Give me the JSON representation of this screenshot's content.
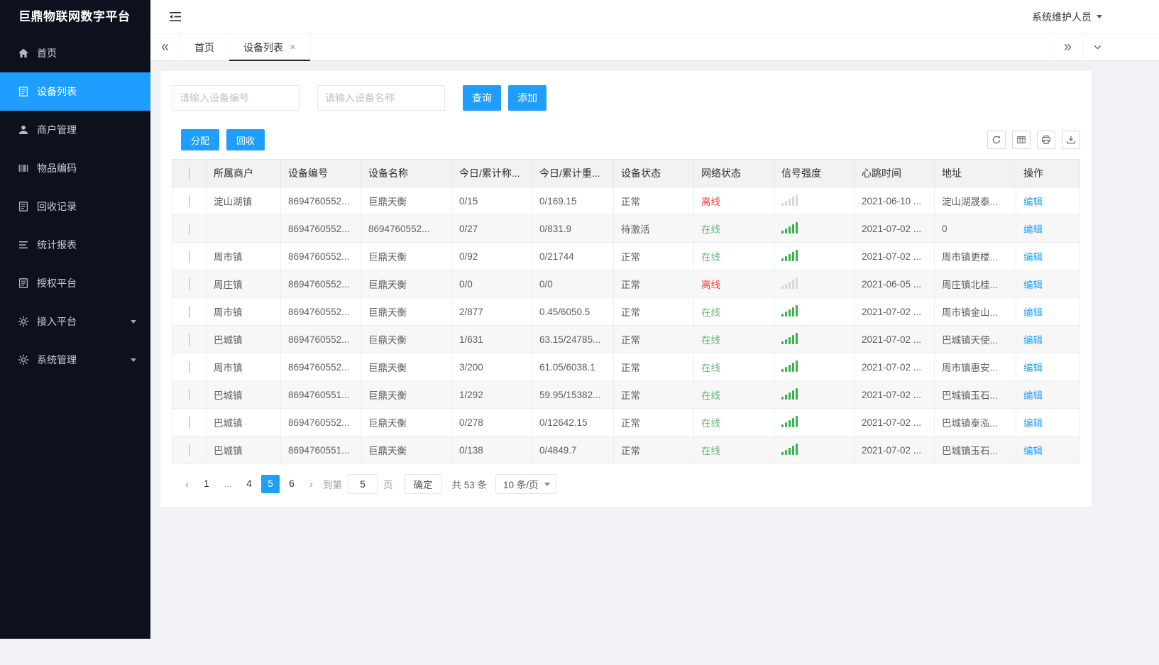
{
  "app": {
    "title": "巨鼎物联网数字平台",
    "user_name": "系统维护人员"
  },
  "colors": {
    "accent": "#1e9fff",
    "sidebar_bg": "#0c111d",
    "page_bg": "#f0f2f5",
    "online_green": "#5fb878",
    "offline_red": "#ff3b3b",
    "signal_strong": "#36b34a",
    "signal_weak": "#d8d8d8",
    "link_blue": "#1e9fff"
  },
  "sidebar": {
    "items": [
      {
        "label": "首页",
        "icon": "home-icon",
        "active": false,
        "expandable": false
      },
      {
        "label": "设备列表",
        "icon": "device-list-icon",
        "active": true,
        "expandable": false
      },
      {
        "label": "商户管理",
        "icon": "merchant-icon",
        "active": false,
        "expandable": false
      },
      {
        "label": "物品编码",
        "icon": "item-code-icon",
        "active": false,
        "expandable": false
      },
      {
        "label": "回收记录",
        "icon": "recycle-record-icon",
        "active": false,
        "expandable": false
      },
      {
        "label": "统计报表",
        "icon": "report-icon",
        "active": false,
        "expandable": false
      },
      {
        "label": "授权平台",
        "icon": "auth-platform-icon",
        "active": false,
        "expandable": false
      },
      {
        "label": "接入平台",
        "icon": "access-platform-icon",
        "active": false,
        "expandable": true
      },
      {
        "label": "系统管理",
        "icon": "system-manage-icon",
        "active": false,
        "expandable": true
      }
    ]
  },
  "tabs": {
    "items": [
      {
        "label": "首页",
        "active": false,
        "closable": false
      },
      {
        "label": "设备列表",
        "active": true,
        "closable": true
      }
    ]
  },
  "filters": {
    "device_no_placeholder": "请输入设备编号",
    "device_name_placeholder": "请输入设备名称",
    "search_label": "查询",
    "add_label": "添加"
  },
  "toolbar": {
    "assign_label": "分配",
    "recycle_label": "回收",
    "icons": [
      "refresh-icon",
      "columns-icon",
      "print-icon",
      "export-icon"
    ]
  },
  "table": {
    "headers": [
      "所属商户",
      "设备编号",
      "设备名称",
      "今日/累计称...",
      "今日/累计重...",
      "设备状态",
      "网络状态",
      "信号强度",
      "心跳时间",
      "地址",
      "操作"
    ],
    "edit_label": "编辑",
    "rows": [
      {
        "merchant": "淀山湖镇",
        "device_no": "8694760552...",
        "device_name": "巨鼎天衡",
        "weigh_count": "0/15",
        "weigh_weight": "0/169.15",
        "device_status": "正常",
        "network_status": "离线",
        "network_state": "offline",
        "signal": "weak",
        "heartbeat": "2021-06-10 ...",
        "address": "淀山湖晟泰..."
      },
      {
        "merchant": "",
        "device_no": "8694760552...",
        "device_name": "8694760552...",
        "weigh_count": "0/27",
        "weigh_weight": "0/831.9",
        "device_status": "待激活",
        "network_status": "在线",
        "network_state": "online",
        "signal": "strong",
        "heartbeat": "2021-07-02 ...",
        "address": "0"
      },
      {
        "merchant": "周市镇",
        "device_no": "8694760552...",
        "device_name": "巨鼎天衡",
        "weigh_count": "0/92",
        "weigh_weight": "0/21744",
        "device_status": "正常",
        "network_status": "在线",
        "network_state": "online",
        "signal": "strong",
        "heartbeat": "2021-07-02 ...",
        "address": "周市镇更楼..."
      },
      {
        "merchant": "周庄镇",
        "device_no": "8694760552...",
        "device_name": "巨鼎天衡",
        "weigh_count": "0/0",
        "weigh_weight": "0/0",
        "device_status": "正常",
        "network_status": "离线",
        "network_state": "offline",
        "signal": "weak",
        "heartbeat": "2021-06-05 ...",
        "address": "周庄镇北桂..."
      },
      {
        "merchant": "周市镇",
        "device_no": "8694760552...",
        "device_name": "巨鼎天衡",
        "weigh_count": "2/877",
        "weigh_weight": "0.45/6050.5",
        "device_status": "正常",
        "network_status": "在线",
        "network_state": "online",
        "signal": "strong",
        "heartbeat": "2021-07-02 ...",
        "address": "周市镇金山..."
      },
      {
        "merchant": "巴城镇",
        "device_no": "8694760552...",
        "device_name": "巨鼎天衡",
        "weigh_count": "1/631",
        "weigh_weight": "63.15/24785...",
        "device_status": "正常",
        "network_status": "在线",
        "network_state": "online",
        "signal": "strong",
        "heartbeat": "2021-07-02 ...",
        "address": "巴城镇天使..."
      },
      {
        "merchant": "周市镇",
        "device_no": "8694760552...",
        "device_name": "巨鼎天衡",
        "weigh_count": "3/200",
        "weigh_weight": "61.05/6038.1",
        "device_status": "正常",
        "network_status": "在线",
        "network_state": "online",
        "signal": "strong",
        "heartbeat": "2021-07-02 ...",
        "address": "周市镇惠安..."
      },
      {
        "merchant": "巴城镇",
        "device_no": "8694760551...",
        "device_name": "巨鼎天衡",
        "weigh_count": "1/292",
        "weigh_weight": "59.95/15382...",
        "device_status": "正常",
        "network_status": "在线",
        "network_state": "online",
        "signal": "strong",
        "heartbeat": "2021-07-02 ...",
        "address": "巴城镇玉石..."
      },
      {
        "merchant": "巴城镇",
        "device_no": "8694760552...",
        "device_name": "巨鼎天衡",
        "weigh_count": "0/278",
        "weigh_weight": "0/12642.15",
        "device_status": "正常",
        "network_status": "在线",
        "network_state": "online",
        "signal": "strong",
        "heartbeat": "2021-07-02 ...",
        "address": "巴城镇泰泓..."
      },
      {
        "merchant": "巴城镇",
        "device_no": "8694760551...",
        "device_name": "巨鼎天衡",
        "weigh_count": "0/138",
        "weigh_weight": "0/4849.7",
        "device_status": "正常",
        "network_status": "在线",
        "network_state": "online",
        "signal": "strong",
        "heartbeat": "2021-07-02 ...",
        "address": "巴城镇玉石..."
      }
    ]
  },
  "pagination": {
    "pages": [
      "1",
      "...",
      "4",
      "5",
      "6"
    ],
    "active_page": "5",
    "goto_label": "到第",
    "goto_value": "5",
    "page_unit_label": "页",
    "confirm_label": "确定",
    "total_label": "共 53 条",
    "page_size_value": "10 条/页"
  }
}
